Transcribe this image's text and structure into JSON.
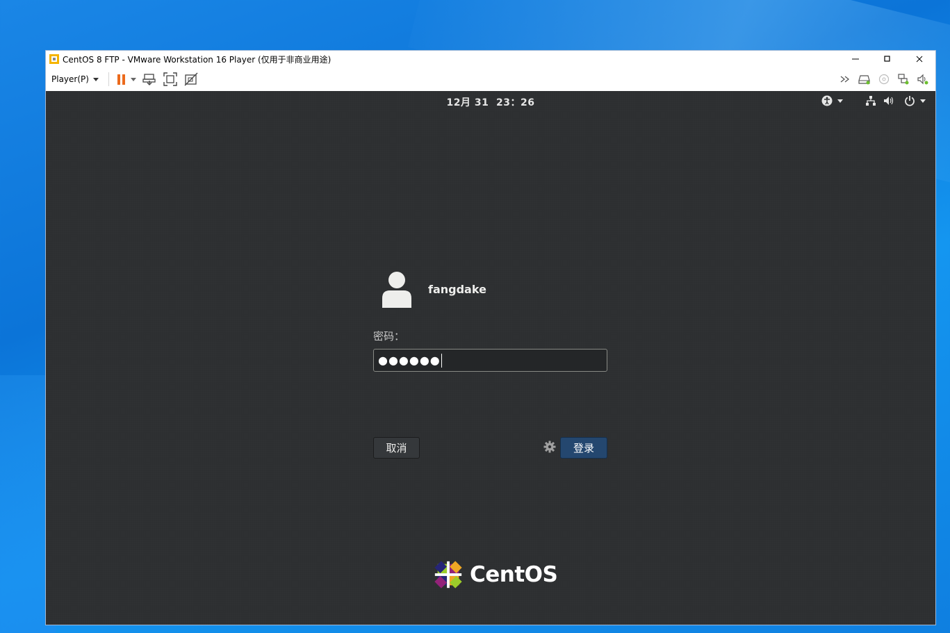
{
  "window": {
    "title": "CentOS 8 FTP - VMware Workstation 16 Player (仅用于非商业用途)",
    "controls": {
      "minimize": "−",
      "maximize": "□",
      "close": "✕"
    }
  },
  "toolbar": {
    "player_menu": "Player(P)",
    "icons_left": [
      "pause-icon",
      "send-ctrl-alt-del-icon",
      "fit-guest-icon",
      "unity-icon"
    ],
    "icons_right": [
      "more-icon",
      "hard-disk-icon",
      "cd-icon",
      "network-adapter-icon",
      "sound-icon"
    ]
  },
  "gnome": {
    "clock": "12月 31  23：26",
    "indicators": [
      "accessibility-icon",
      "network-icon",
      "volume-icon",
      "power-icon"
    ]
  },
  "login": {
    "username": "fangdake",
    "password_label": "密码：",
    "password_masked": "●●●●●●",
    "cancel_label": "取消",
    "login_label": "登录"
  },
  "branding": {
    "text": "CentOS"
  },
  "colors": {
    "accent_orange": "#ec6a1c",
    "login_button": "#24476f",
    "vm_background": "#2d2f31"
  }
}
